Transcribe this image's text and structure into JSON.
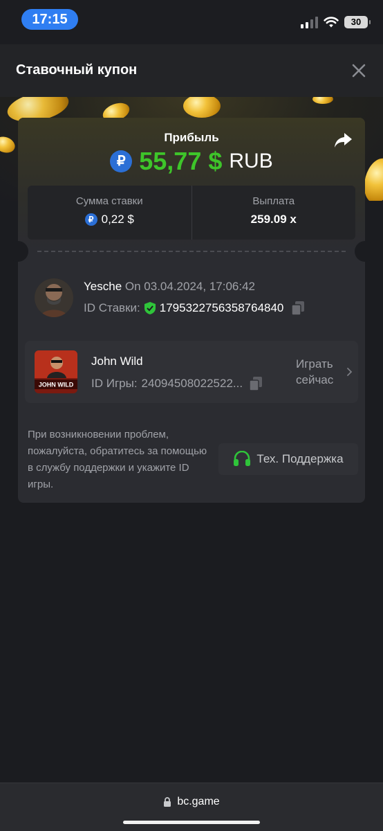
{
  "status_bar": {
    "time": "17:15",
    "battery": "30"
  },
  "header": {
    "title": "Ставочный купон",
    "close_icon": "close-icon"
  },
  "colors": {
    "profit_green": "#3ec52a",
    "rub_blue": "#2b6fd6",
    "accent_pill": "#2f7ef2",
    "shield_green": "#2fc43a"
  },
  "profit": {
    "label": "Прибыль",
    "currency_symbol": "₽",
    "amount": "55,77 $",
    "currency": "RUB",
    "share_icon": "share-icon"
  },
  "stats": {
    "bet_label": "Сумма ставки",
    "bet_symbol": "₽",
    "bet_value": "0,22 $",
    "payout_label": "Выплата",
    "payout_value": "259.09 x"
  },
  "bet_info": {
    "user": "Yesche",
    "date": "On 03.04.2024, 17:06:42",
    "id_label": "ID Ставки:",
    "id_value": "1795322756358764840"
  },
  "game": {
    "name": "John Wild",
    "thumb_text": "JOHN WILD",
    "id_label": "ID Игры:",
    "id_value": "24094508022522...",
    "play_label": "Играть сейчас"
  },
  "support": {
    "help_text": "При возникновении проблем, пожалуйста, обратитесь за помощью в службу поддержки и укажите ID игры.",
    "button_label": "Тех. Поддержка"
  },
  "browser": {
    "url": "bc.game"
  }
}
